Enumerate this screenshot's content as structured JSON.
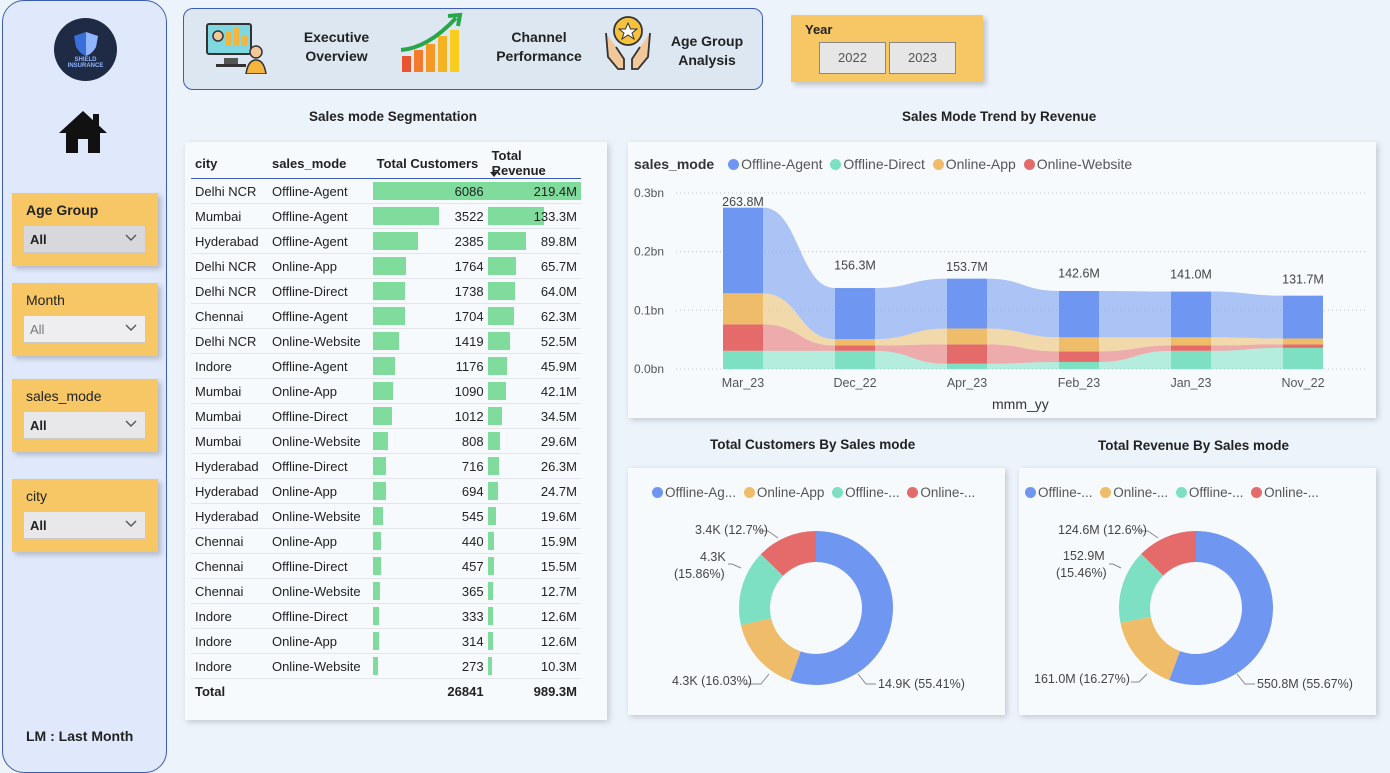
{
  "sidebar": {
    "logo_text_1": "SHIELD",
    "logo_text_2": "INSURANCE",
    "slicers": [
      {
        "label": "Age Group",
        "value": "All"
      },
      {
        "label": "Month",
        "value": "All"
      },
      {
        "label": "sales_mode",
        "value": "All"
      },
      {
        "label": "city",
        "value": "All"
      }
    ],
    "footnote": "LM : Last Month"
  },
  "nav": {
    "item1_l1": "Executive",
    "item1_l2": "Overview",
    "item2_l1": "Channel",
    "item2_l2": "Performance",
    "item3_l1": "Age Group",
    "item3_l2": "Analysis"
  },
  "year": {
    "label": "Year",
    "options": [
      "2022",
      "2023"
    ]
  },
  "titles": {
    "segmentation": "Sales mode Segmentation",
    "trend": "Sales Mode Trend by Revenue",
    "customers_donut": "Total Customers By Sales mode",
    "revenue_donut": "Total Revenue By Sales mode"
  },
  "table": {
    "headers": [
      "city",
      "sales_mode",
      "Total Customers",
      "Total Revenue"
    ],
    "rows": [
      [
        "Delhi NCR",
        "Offline-Agent",
        "6086",
        "219.4M"
      ],
      [
        "Mumbai",
        "Offline-Agent",
        "3522",
        "133.3M"
      ],
      [
        "Hyderabad",
        "Offline-Agent",
        "2385",
        "89.8M"
      ],
      [
        "Delhi NCR",
        "Online-App",
        "1764",
        "65.7M"
      ],
      [
        "Delhi NCR",
        "Offline-Direct",
        "1738",
        "64.0M"
      ],
      [
        "Chennai",
        "Offline-Agent",
        "1704",
        "62.3M"
      ],
      [
        "Delhi NCR",
        "Online-Website",
        "1419",
        "52.5M"
      ],
      [
        "Indore",
        "Offline-Agent",
        "1176",
        "45.9M"
      ],
      [
        "Mumbai",
        "Online-App",
        "1090",
        "42.1M"
      ],
      [
        "Mumbai",
        "Offline-Direct",
        "1012",
        "34.5M"
      ],
      [
        "Mumbai",
        "Online-Website",
        "808",
        "29.6M"
      ],
      [
        "Hyderabad",
        "Offline-Direct",
        "716",
        "26.3M"
      ],
      [
        "Hyderabad",
        "Online-App",
        "694",
        "24.7M"
      ],
      [
        "Hyderabad",
        "Online-Website",
        "545",
        "19.6M"
      ],
      [
        "Chennai",
        "Online-App",
        "440",
        "15.9M"
      ],
      [
        "Chennai",
        "Offline-Direct",
        "457",
        "15.5M"
      ],
      [
        "Chennai",
        "Online-Website",
        "365",
        "12.7M"
      ],
      [
        "Indore",
        "Offline-Direct",
        "333",
        "12.6M"
      ],
      [
        "Indore",
        "Online-App",
        "314",
        "12.6M"
      ],
      [
        "Indore",
        "Online-Website",
        "273",
        "10.3M"
      ]
    ],
    "total": [
      "Total",
      "",
      "26841",
      "989.3M"
    ]
  },
  "colors": {
    "offline_agent": "#6f96f0",
    "offline_direct": "#7de0c2",
    "online_app": "#efbd6a",
    "online_website": "#e56a6a",
    "bar_green": "#7fdc9c"
  },
  "chart_data": [
    {
      "type": "area",
      "title": "Sales Mode Trend by Revenue",
      "legend_title": "sales_mode",
      "xlabel": "mmm_yy",
      "categories": [
        "Mar_23",
        "Dec_22",
        "Apr_23",
        "Feb_23",
        "Jan_23",
        "Nov_22"
      ],
      "totals_labels": [
        "263.8M",
        "156.3M",
        "153.7M",
        "142.6M",
        "141.0M",
        "131.7M"
      ],
      "totals": [
        263.8,
        156.3,
        153.7,
        142.6,
        141.0,
        131.7
      ],
      "yticks": [
        "0.0bn",
        "0.1bn",
        "0.2bn",
        "0.3bn"
      ],
      "ylim": [
        0,
        0.3
      ],
      "series": [
        {
          "name": "Offline-Agent",
          "values": [
            0.146,
            0.087,
            0.085,
            0.079,
            0.078,
            0.073
          ]
        },
        {
          "name": "Offline-Direct",
          "values": [
            0.031,
            0.031,
            0.009,
            0.012,
            0.031,
            0.036
          ]
        },
        {
          "name": "Online-App",
          "values": [
            0.053,
            0.011,
            0.027,
            0.024,
            0.014,
            0.01
          ]
        },
        {
          "name": "Online-Website",
          "values": [
            0.045,
            0.009,
            0.033,
            0.018,
            0.009,
            0.006
          ]
        }
      ]
    },
    {
      "type": "pie",
      "title": "Total Customers By Sales mode",
      "legend": [
        "Offline-Ag...",
        "Online-App",
        "Offline-...",
        "Online-..."
      ],
      "categories": [
        "Offline-Agent",
        "Online-App",
        "Offline-Direct",
        "Online-Website"
      ],
      "values": [
        55.41,
        16.03,
        15.86,
        12.7
      ],
      "labels": [
        "14.9K (55.41%)",
        "4.3K (16.03%)",
        "4.3K",
        "(15.86%)",
        "3.4K (12.7%)"
      ]
    },
    {
      "type": "pie",
      "title": "Total Revenue By Sales mode",
      "legend": [
        "Offline-...",
        "Online-...",
        "Offline-...",
        "Online-..."
      ],
      "categories": [
        "Offline-Agent",
        "Online-App",
        "Offline-Direct",
        "Online-Website"
      ],
      "values": [
        55.67,
        16.27,
        15.46,
        12.6
      ],
      "labels": [
        "550.8M (55.67%)",
        "161.0M (16.27%)",
        "152.9M",
        "(15.46%)",
        "124.6M (12.6%)"
      ]
    }
  ]
}
